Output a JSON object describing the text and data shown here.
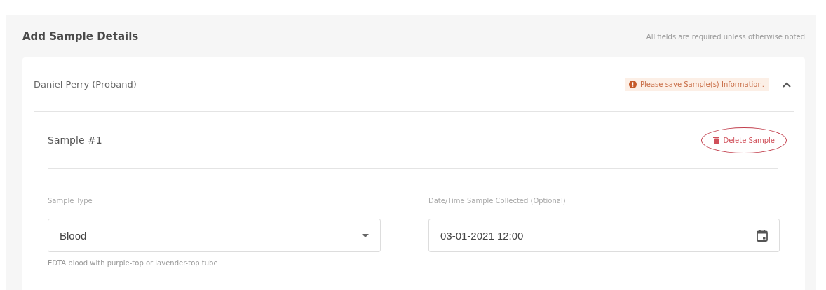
{
  "section": {
    "title": "Add Sample Details",
    "note": "All fields are required unless otherwise noted"
  },
  "patient": {
    "name": "Daniel Perry (Proband)",
    "warning": "Please save Sample(s) Information.",
    "expanded": true
  },
  "sample": {
    "title": "Sample #1",
    "delete_button": "Delete Sample"
  },
  "fields": [
    {
      "kind": "select",
      "label": "Sample Type",
      "value": "Blood",
      "help": "EDTA blood with purple-top or lavender-top tube"
    },
    {
      "kind": "date",
      "label": "Date/Time Sample Collected (Optional)",
      "value": "03-01-2021 12:00"
    }
  ]
}
